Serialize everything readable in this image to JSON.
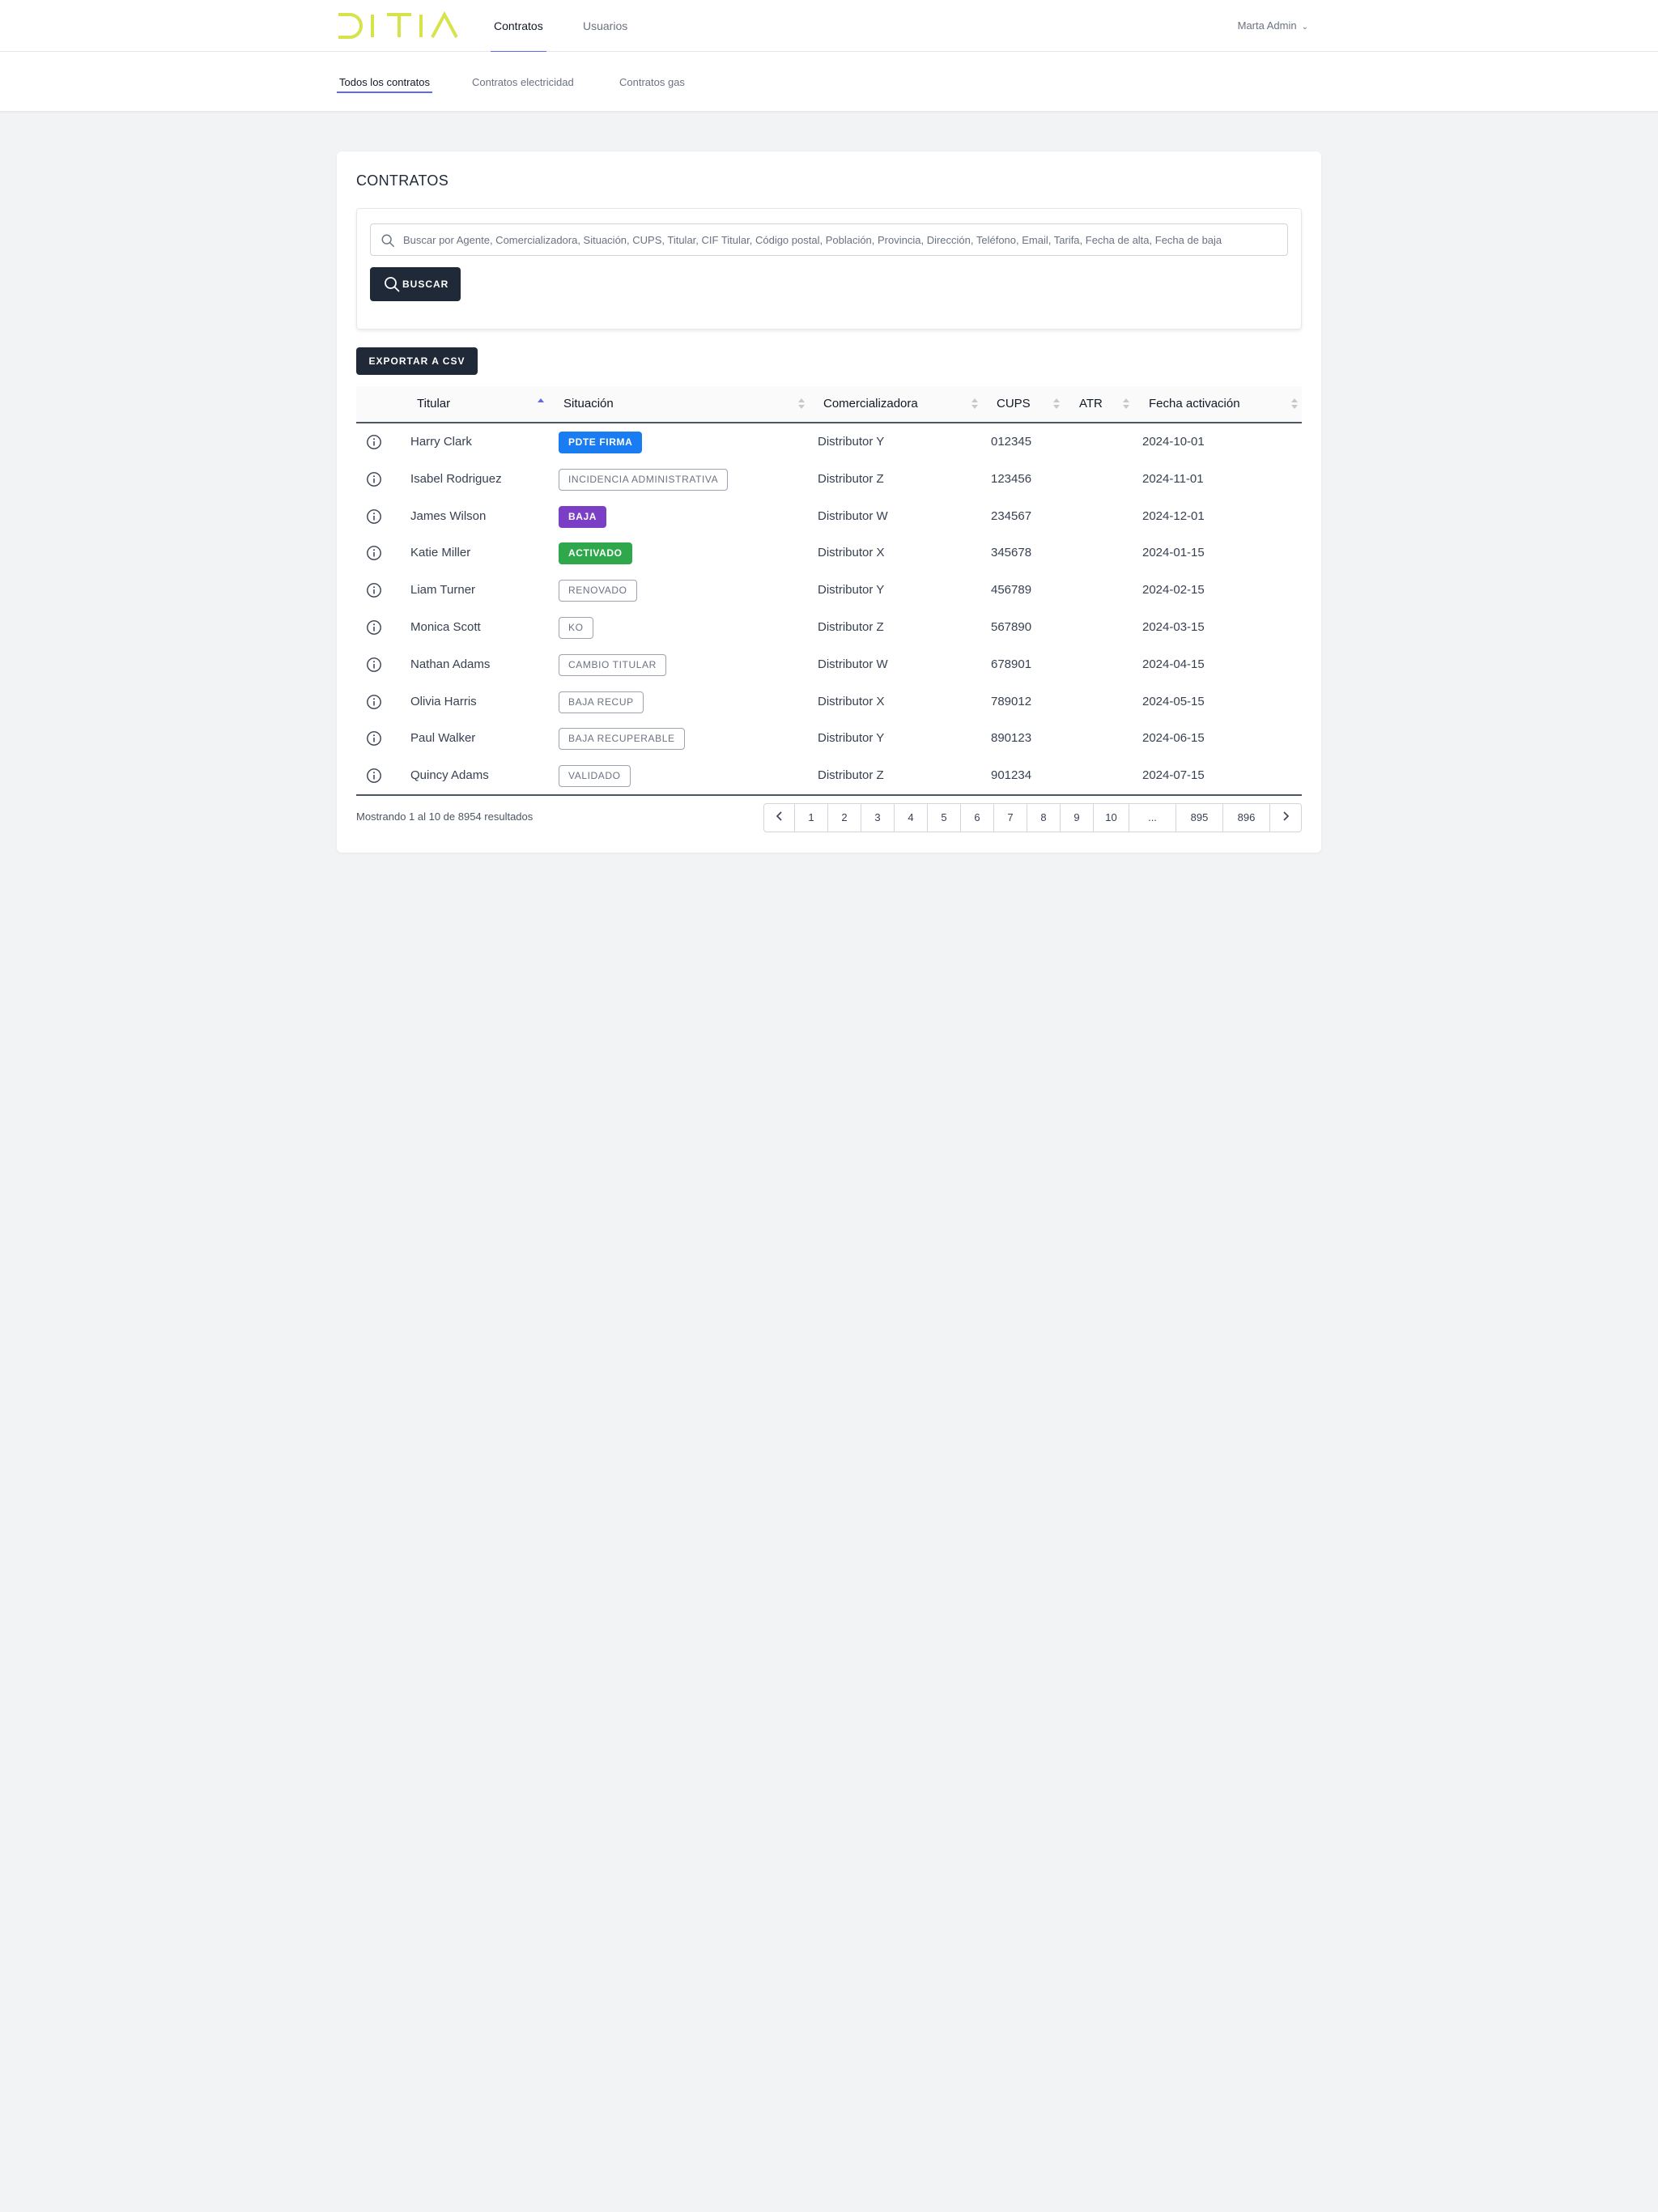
{
  "brand": {
    "logo_text": "DITIA",
    "logo_color": "#d6e34a"
  },
  "nav": {
    "tabs": [
      {
        "label": "Contratos",
        "active": true
      },
      {
        "label": "Usuarios",
        "active": false
      }
    ],
    "user": "Marta Admin"
  },
  "subnav": {
    "tabs": [
      {
        "label": "Todos los contratos",
        "active": true
      },
      {
        "label": "Contratos electricidad",
        "active": false
      },
      {
        "label": "Contratos gas",
        "active": false
      }
    ]
  },
  "main": {
    "title": "CONTRATOS",
    "search": {
      "placeholder": "Buscar por Agente, Comercializadora, Situación, CUPS, Titular, CIF Titular, Código postal, Población, Provincia, Dirección, Teléfono, Email, Tarifa, Fecha de alta, Fecha de baja",
      "value": "",
      "button_label": "BUSCAR"
    },
    "export_label": "EXPORTAR A CSV"
  },
  "table": {
    "columns": [
      "Titular",
      "Situación",
      "Comercializadora",
      "CUPS",
      "ATR",
      "Fecha activación"
    ],
    "sorted_column": "Titular",
    "sort_direction": "asc",
    "rows": [
      {
        "titular": "Harry Clark",
        "situacion": "PDTE FIRMA",
        "comercializadora": "Distributor Y",
        "cups": "012345",
        "atr": "",
        "fecha": "2024-10-01"
      },
      {
        "titular": "Isabel Rodriguez",
        "situacion": "INCIDENCIA ADMINISTRATIVA",
        "comercializadora": "Distributor Z",
        "cups": "123456",
        "atr": "",
        "fecha": "2024-11-01"
      },
      {
        "titular": "James Wilson",
        "situacion": "BAJA",
        "comercializadora": "Distributor W",
        "cups": "234567",
        "atr": "",
        "fecha": "2024-12-01"
      },
      {
        "titular": "Katie Miller",
        "situacion": "ACTIVADO",
        "comercializadora": "Distributor X",
        "cups": "345678",
        "atr": "",
        "fecha": "2024-01-15"
      },
      {
        "titular": "Liam Turner",
        "situacion": "RENOVADO",
        "comercializadora": "Distributor Y",
        "cups": "456789",
        "atr": "",
        "fecha": "2024-02-15"
      },
      {
        "titular": "Monica Scott",
        "situacion": "KO",
        "comercializadora": "Distributor Z",
        "cups": "567890",
        "atr": "",
        "fecha": "2024-03-15"
      },
      {
        "titular": "Nathan Adams",
        "situacion": "CAMBIO TITULAR",
        "comercializadora": "Distributor W",
        "cups": "678901",
        "atr": "",
        "fecha": "2024-04-15"
      },
      {
        "titular": "Olivia Harris",
        "situacion": "BAJA RECUP",
        "comercializadora": "Distributor X",
        "cups": "789012",
        "atr": "",
        "fecha": "2024-05-15"
      },
      {
        "titular": "Paul Walker",
        "situacion": "BAJA RECUPERABLE",
        "comercializadora": "Distributor Y",
        "cups": "890123",
        "atr": "",
        "fecha": "2024-06-15"
      },
      {
        "titular": "Quincy Adams",
        "situacion": "VALIDADO",
        "comercializadora": "Distributor Z",
        "cups": "901234",
        "atr": "",
        "fecha": "2024-07-15"
      }
    ]
  },
  "status_styles": {
    "PDTE FIRMA": {
      "style": "solid",
      "color": "#1a7cf2"
    },
    "BAJA": {
      "style": "solid",
      "color": "#7b3fc6"
    },
    "ACTIVADO": {
      "style": "solid",
      "color": "#2ea84a"
    },
    "default": {
      "style": "outline",
      "color": "#9ca3af"
    }
  },
  "pagination": {
    "summary": "Mostrando 1 al 10 de 8954 resultados",
    "prev_icon": "chevron-left-icon",
    "next_icon": "chevron-right-icon",
    "pages": [
      "1",
      "2",
      "3",
      "4",
      "5",
      "6",
      "7",
      "8",
      "9",
      "10",
      "...",
      "895",
      "896"
    ],
    "current_page": "1"
  },
  "icons": {
    "search": "search-icon",
    "info": "info-icon",
    "user_menu": "chevron-down-icon"
  }
}
